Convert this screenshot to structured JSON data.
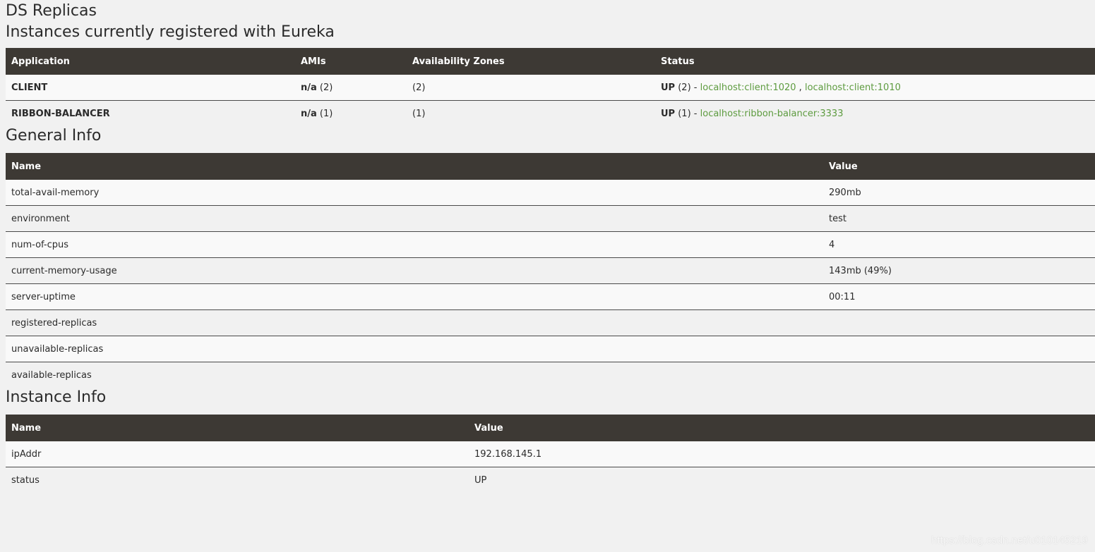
{
  "titles": {
    "ds_replicas": "DS Replicas",
    "instances": "Instances currently registered with Eureka",
    "general_info": "General Info",
    "instance_info": "Instance Info"
  },
  "apps_table": {
    "headers": [
      "Application",
      "AMIs",
      "Availability Zones",
      "Status"
    ],
    "rows": [
      {
        "application": "CLIENT",
        "ami_bold": "n/a",
        "ami_count": "(2)",
        "zones": "(2)",
        "status_bold": "UP",
        "status_count": "(2) -",
        "links": [
          "localhost:client:1020",
          "localhost:client:1010"
        ],
        "link_sep": ","
      },
      {
        "application": "RIBBON-BALANCER",
        "ami_bold": "n/a",
        "ami_count": "(1)",
        "zones": "(1)",
        "status_bold": "UP",
        "status_count": "(1) -",
        "links": [
          "localhost:ribbon-balancer:3333"
        ]
      }
    ]
  },
  "general_table": {
    "headers": [
      "Name",
      "Value"
    ],
    "rows": [
      {
        "name": "total-avail-memory",
        "value": "290mb"
      },
      {
        "name": "environment",
        "value": "test"
      },
      {
        "name": "num-of-cpus",
        "value": "4"
      },
      {
        "name": "current-memory-usage",
        "value": "143mb (49%)"
      },
      {
        "name": "server-uptime",
        "value": "00:11"
      },
      {
        "name": "registered-replicas",
        "value": ""
      },
      {
        "name": "unavailable-replicas",
        "value": ""
      },
      {
        "name": "available-replicas",
        "value": ""
      }
    ]
  },
  "instance_table": {
    "headers": [
      "Name",
      "Value"
    ],
    "rows": [
      {
        "name": "ipAddr",
        "value": "192.168.145.1"
      },
      {
        "name": "status",
        "value": "UP"
      }
    ]
  },
  "watermark": "https://blog.csdn.net/u010145219",
  "colors": {
    "header_bg": "#3d3934",
    "link": "#5d9b3f",
    "page_bg": "#f1f1f1"
  }
}
